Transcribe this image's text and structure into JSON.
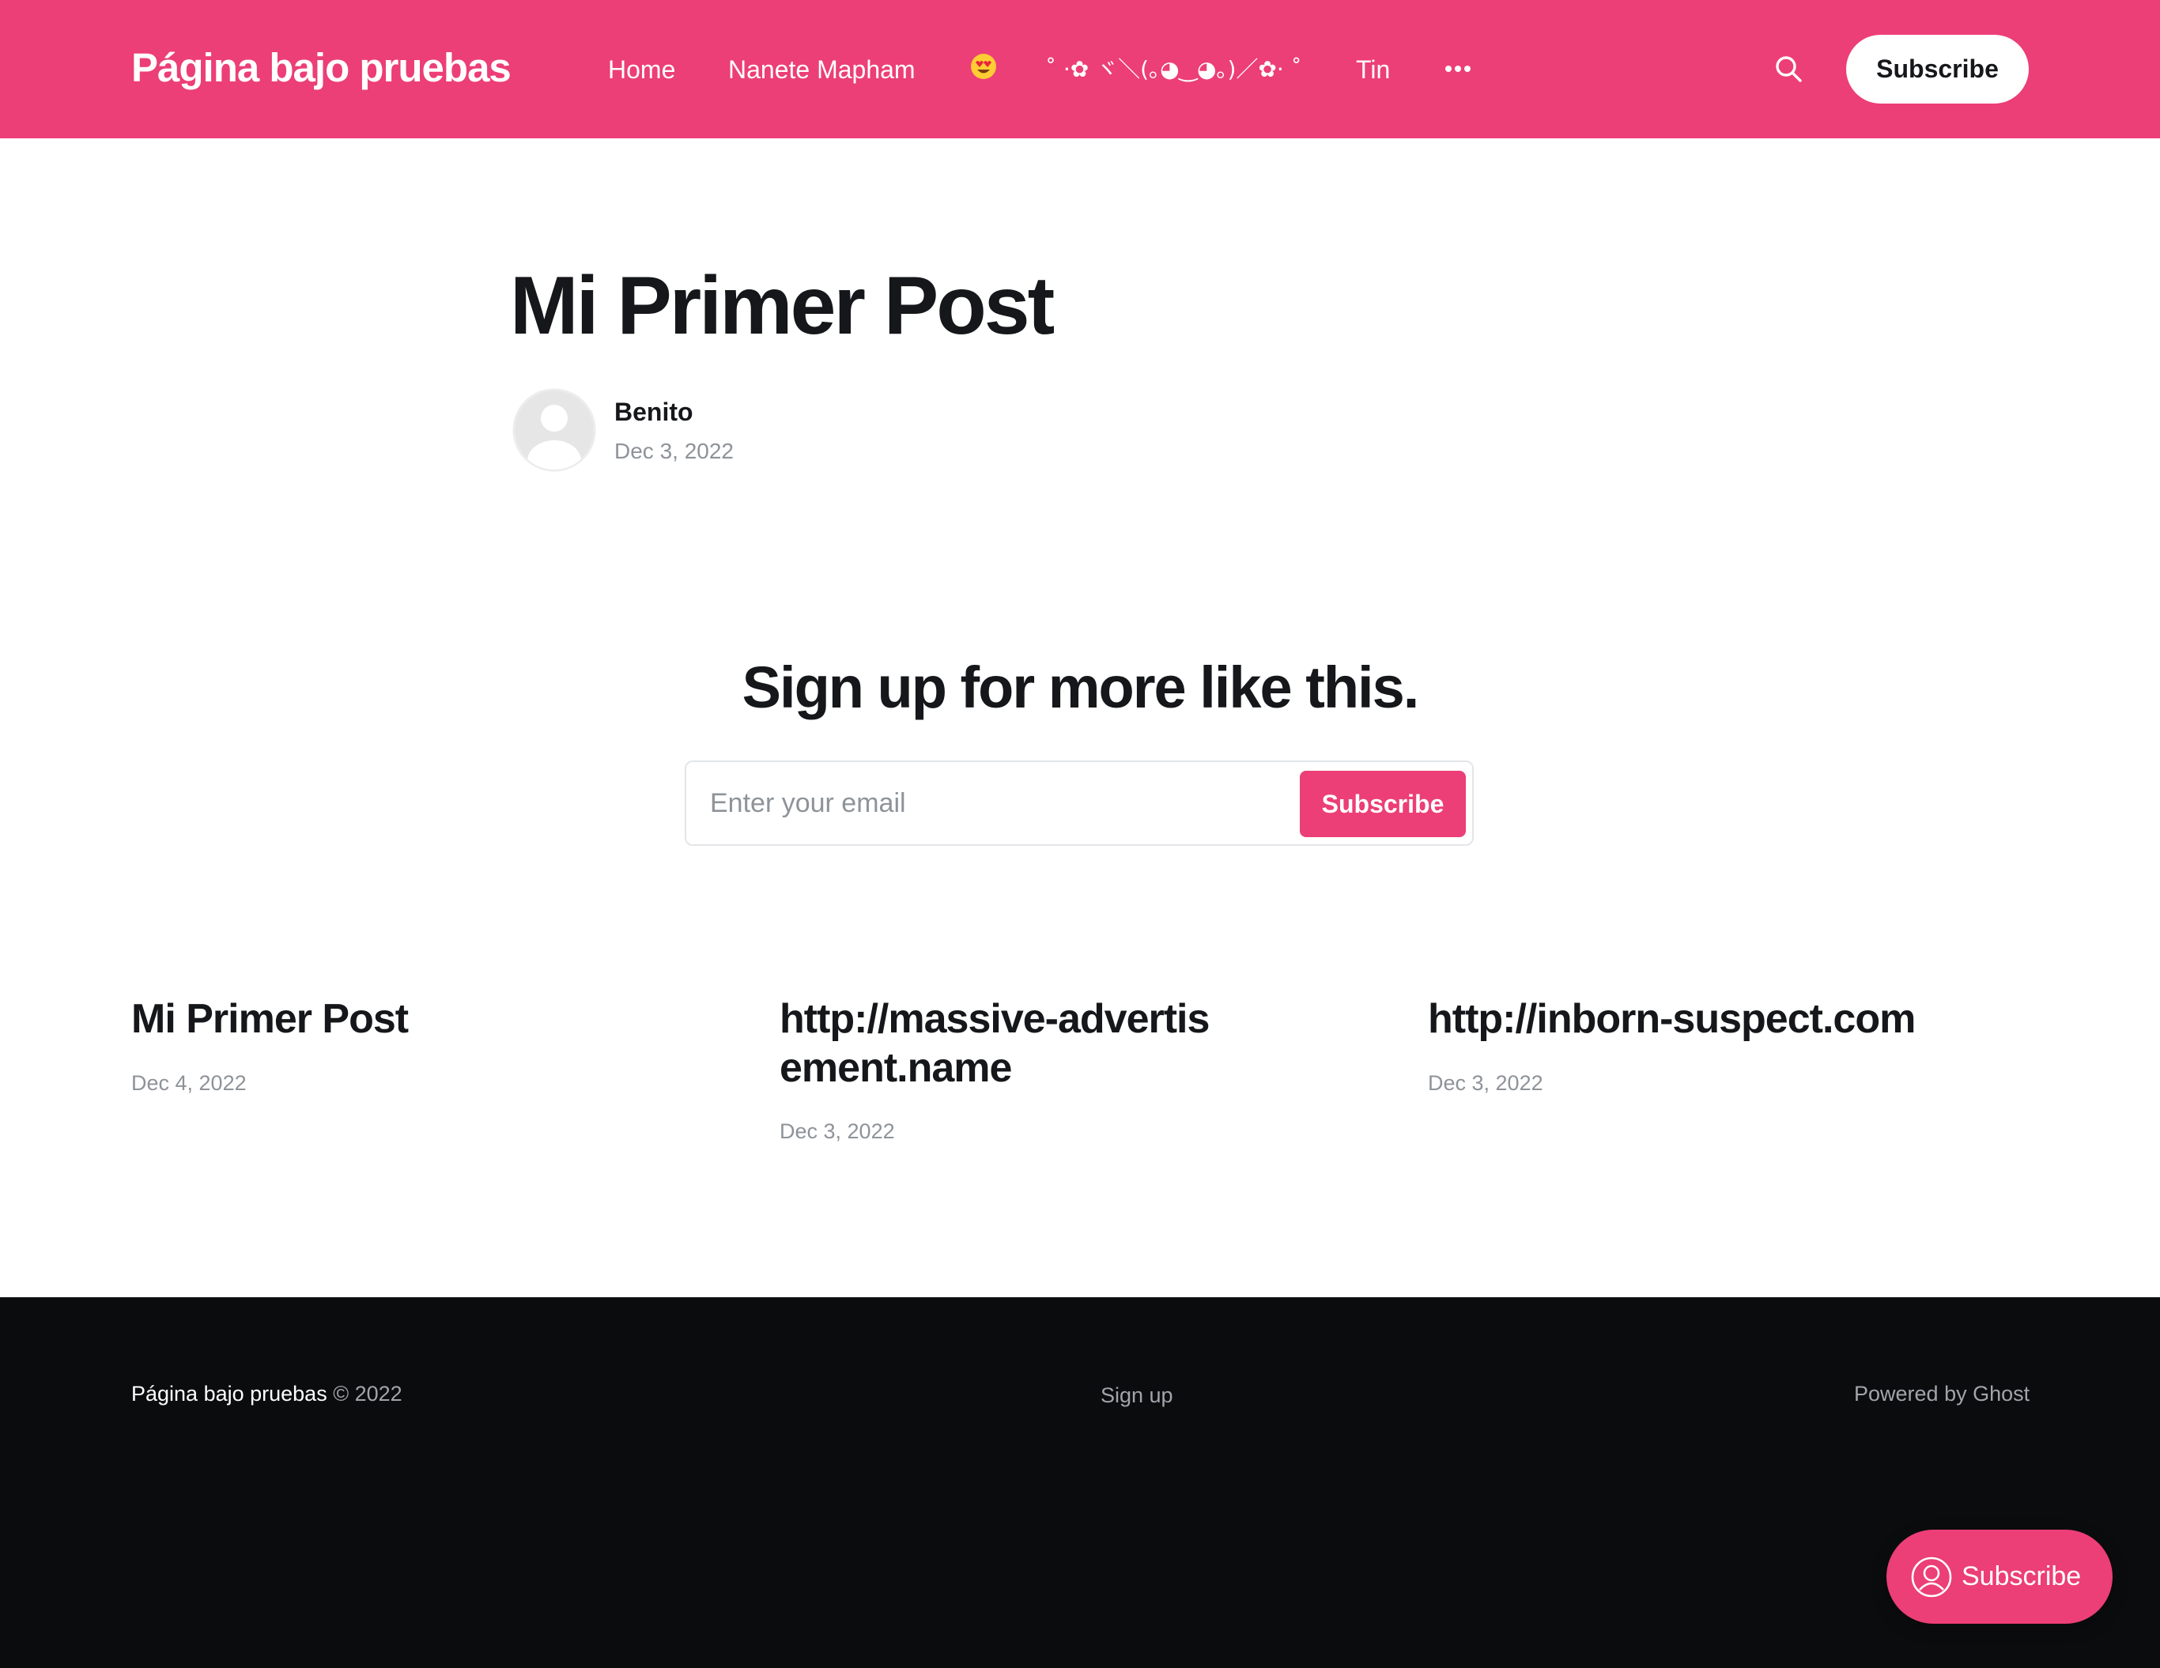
{
  "header": {
    "site_title": "Página bajo pruebas",
    "nav": [
      {
        "label": "Home"
      },
      {
        "label": "Nanete Mapham"
      },
      {
        "label": "😍"
      },
      {
        "label": "˚ ·✿ ヾ＼(｡◕‿◕｡)／✿· ˚"
      },
      {
        "label": "Tin"
      }
    ],
    "more_icon": "more-horizontal-icon",
    "search_icon": "search-icon",
    "subscribe_label": "Subscribe",
    "background_color": "#ec3e77"
  },
  "post": {
    "title": "Mi Primer Post",
    "author": "Benito",
    "date": "Dec 3, 2022",
    "avatar_icon": "default-avatar-icon"
  },
  "cta": {
    "title": "Sign up for more like this.",
    "email_placeholder": "Enter your email",
    "subscribe_label": "Subscribe"
  },
  "related": [
    {
      "title": "Mi Primer Post",
      "date": "Dec 4, 2022"
    },
    {
      "title": "http://massive-advertisement.name",
      "date": "Dec 3, 2022"
    },
    {
      "title": "http://inborn-suspect.com",
      "date": "Dec 3, 2022"
    }
  ],
  "footer": {
    "site_name": "Página bajo pruebas",
    "copyright": " © 2022",
    "signup_label": "Sign up",
    "powered_by": "Powered by Ghost"
  },
  "portal": {
    "label": "Subscribe",
    "icon": "user-circle-icon"
  },
  "colors": {
    "accent": "#ec3e77",
    "text_dark": "#15171a",
    "text_muted": "#8e9399",
    "footer_bg": "#0b0c0e"
  }
}
